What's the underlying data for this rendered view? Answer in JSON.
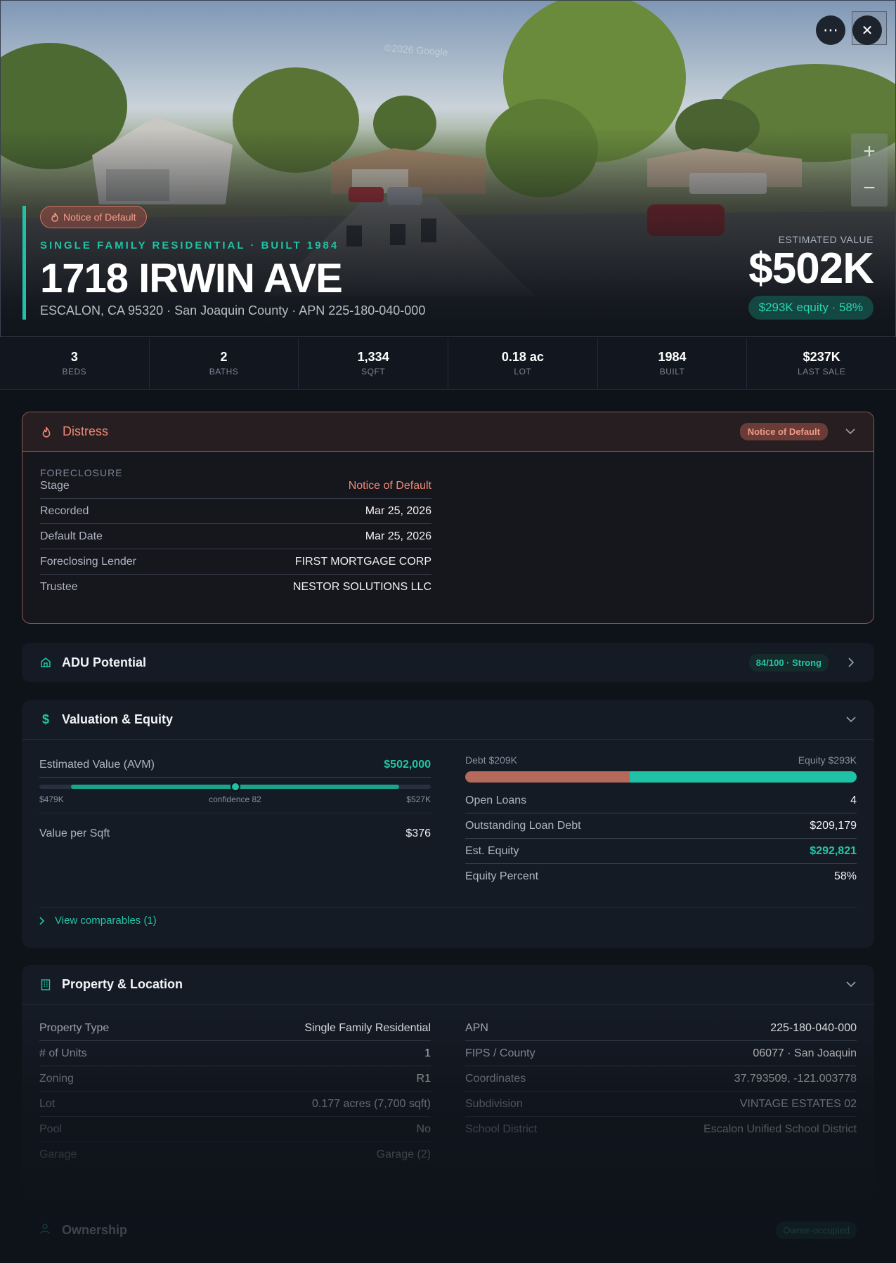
{
  "hero": {
    "watermark": "©2026 Google",
    "distress_pill": "Notice of Default",
    "subtitle": "SINGLE FAMILY RESIDENTIAL · BUILT 1984",
    "title": "1718 IRWIN AVE",
    "address": "ESCALON, CA 95320 · San Joaquin County · APN 225-180-040-000",
    "estimated_value_label": "ESTIMATED VALUE",
    "estimated_value": "$502K",
    "equity_pill": "$293K equity · 58%",
    "more_icon": "⋯",
    "close_icon": "✕",
    "zoom_in": "+",
    "zoom_out": "−"
  },
  "stats": [
    {
      "value": "3",
      "label": "BEDS"
    },
    {
      "value": "2",
      "label": "BATHS"
    },
    {
      "value": "1,334",
      "label": "SQFT"
    },
    {
      "value": "0.18 ac",
      "label": "LOT"
    },
    {
      "value": "1984",
      "label": "BUILT"
    },
    {
      "value": "$237K",
      "label": "LAST SALE"
    }
  ],
  "distress": {
    "title": "Distress",
    "badge": "Notice of Default",
    "section": "FORECLOSURE",
    "rows": [
      {
        "k": "Stage",
        "v": "Notice of Default"
      },
      {
        "k": "Recorded",
        "v": "Mar 25, 2026"
      },
      {
        "k": "Default Date",
        "v": "Mar 25, 2026"
      },
      {
        "k": "Foreclosing Lender",
        "v": "FIRST MORTGAGE CORP"
      },
      {
        "k": "Trustee",
        "v": "NESTOR SOLUTIONS LLC"
      }
    ]
  },
  "adu": {
    "title": "ADU Potential",
    "badge": "84/100 · Strong"
  },
  "valuation": {
    "title": "Valuation & Equity",
    "avm_label": "Estimated Value (AVM)",
    "avm_value": "$502,000",
    "range_low": "$479K",
    "range_high": "$527K",
    "confidence": "confidence 82",
    "range_fill_start": 0.08,
    "range_fill_end": 0.92,
    "range_marker": 0.5,
    "vps_label": "Value per Sqft",
    "vps_value": "$376",
    "debt_label": "Debt $209K",
    "equity_label": "Equity $293K",
    "debt_fraction": 0.42,
    "rows": [
      {
        "k": "Open Loans",
        "v": "4"
      },
      {
        "k": "Outstanding Loan Debt",
        "v": "$209,179"
      },
      {
        "k": "Est. Equity",
        "v": "$292,821"
      },
      {
        "k": "Equity Percent",
        "v": "58%"
      }
    ],
    "comps_link": "View comparables (1)"
  },
  "property": {
    "title": "Property & Location",
    "left": [
      {
        "k": "Property Type",
        "v": "Single Family Residential"
      },
      {
        "k": "# of Units",
        "v": "1"
      },
      {
        "k": "Zoning",
        "v": "R1"
      },
      {
        "k": "Lot",
        "v": "0.177 acres (7,700 sqft)"
      },
      {
        "k": "Pool",
        "v": "No"
      },
      {
        "k": "Garage",
        "v": "Garage (2)"
      }
    ],
    "right": [
      {
        "k": "APN",
        "v": "225-180-040-000"
      },
      {
        "k": "FIPS / County",
        "v": "06077 · San Joaquin"
      },
      {
        "k": "Coordinates",
        "v": "37.793509, -121.003778"
      },
      {
        "k": "Subdivision",
        "v": "VINTAGE ESTATES 02"
      },
      {
        "k": "School District",
        "v": "Escalon Unified School District"
      }
    ]
  },
  "ownership": {
    "title": "Ownership",
    "badge": "Owner-occupied"
  },
  "colors": {
    "accent": "#1fc2a5",
    "distress": "#ee8a76",
    "debt": "#b5695a",
    "bg": "#0e1219"
  }
}
